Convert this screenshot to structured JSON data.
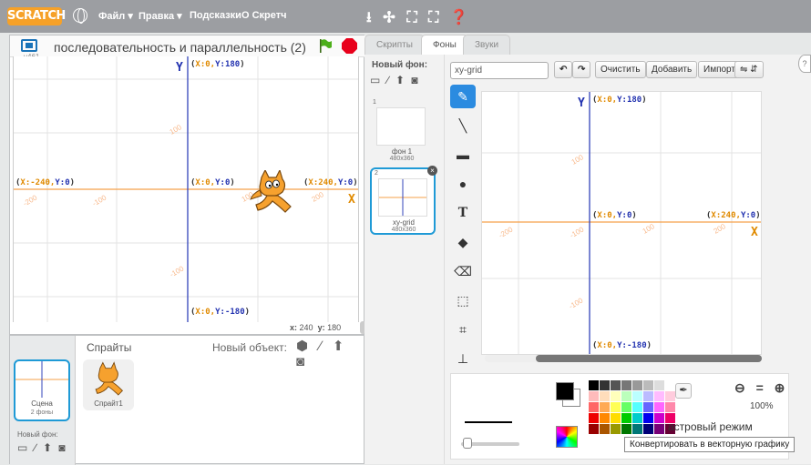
{
  "topbar": {
    "logo": "SCRATCH",
    "menu": [
      "Файл ▾",
      "Правка ▾",
      "Подсказки",
      "О Скретч"
    ],
    "tool_icons": "⭳ ✢ ⛶ ⛶ ❓"
  },
  "stage": {
    "version": "v461",
    "title": "последовательность и параллельность (2)",
    "coords_label_x": "x:",
    "coords_x": "240",
    "coords_label_y": "y:",
    "coords_y": "180",
    "axis_x": "X",
    "axis_y": "Y",
    "labels": {
      "top_x": "X:0,",
      "top_y": "Y:180",
      "bottom_x": "X:0,",
      "bottom_y": "Y:-180",
      "left_x": "X:-240,",
      "left_y": "Y:0",
      "right_x": "X:240,",
      "right_y": "Y:0",
      "center_x": "X:0,",
      "center_y": "Y:0"
    },
    "ticks": [
      "-200",
      "-100",
      "100",
      "200",
      "100",
      "-100"
    ]
  },
  "sprites": {
    "title": "Спрайты",
    "new_object": "Новый объект:",
    "new_object_icons": "⬢ ∕ ⬆ ◙",
    "stage_caption": "Сцена",
    "stage_sub": "2 фоны",
    "sprite_name": "Спрайт1",
    "new_bg": "Новый фон:",
    "new_bg_icons": "▭ ∕ ⬆ ◙"
  },
  "tabs": [
    "Скрипты",
    "Фоны",
    "Звуки"
  ],
  "costumes": {
    "new_label": "Новый фон:",
    "new_icons": "▭ ∕ ⬆ ◙",
    "items": [
      {
        "num": "1",
        "name": "фон 1",
        "size": "480x360"
      },
      {
        "num": "2",
        "name": "xy-grid",
        "size": "480x360"
      }
    ]
  },
  "paint": {
    "name_value": "xy-grid",
    "undo": "↶",
    "redo": "↷",
    "clear": "Очистить",
    "add": "Добавить",
    "import": "Импорт",
    "flip_icons": "⇋ ⇵",
    "canvas": {
      "axis_x": "X",
      "axis_y": "Y",
      "top_x": "X:0,",
      "top_y": "Y:180",
      "center_x": "X:0,",
      "center_y": "Y:0",
      "right_x": "X:240,",
      "right_y": "Y:0",
      "bottom_x": "X:0,",
      "bottom_y": "Y:-180",
      "ticks": [
        "-200",
        "-100",
        "100",
        "200",
        "100",
        "-100"
      ]
    },
    "zoom": "⊖ = ⊕",
    "zoom_value": "100%",
    "mode_text": "астровый режим",
    "tooltip": "Конвертировать в векторную графику"
  },
  "colors": {
    "accent": "#2b8be0",
    "axis_blue": "#3344bb",
    "axis_orange": "#f5a04a"
  }
}
